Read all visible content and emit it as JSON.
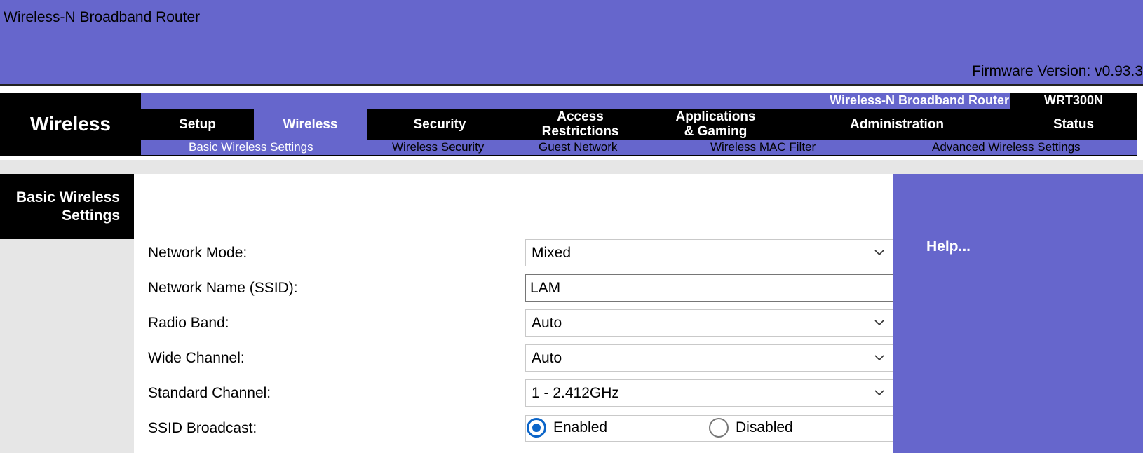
{
  "top": {
    "title": "Wireless-N Broadband Router",
    "firmware": "Firmware Version: v0.93.3"
  },
  "header": {
    "section": "Wireless",
    "product": "Wireless-N Broadband Router",
    "model": "WRT300N",
    "tabs": {
      "setup": "Setup",
      "wireless": "Wireless",
      "security": "Security",
      "access_1": "Access",
      "access_2": "Restrictions",
      "apps_1": "Applications",
      "apps_2": "& Gaming",
      "administration": "Administration",
      "status": "Status"
    },
    "subtabs": {
      "basic": "Basic Wireless Settings",
      "security": "Wireless Security",
      "guest": "Guest Network",
      "mac": "Wireless MAC Filter",
      "advanced": "Advanced Wireless Settings"
    }
  },
  "left": {
    "title_1": "Basic Wireless",
    "title_2": "Settings"
  },
  "help": {
    "label": "Help..."
  },
  "form": {
    "network_mode": {
      "label": "Network Mode:",
      "value": "Mixed"
    },
    "ssid": {
      "label": "Network Name (SSID):",
      "value": "LAM"
    },
    "radio_band": {
      "label": "Radio Band:",
      "value": "Auto"
    },
    "wide_channel": {
      "label": "Wide Channel:",
      "value": "Auto"
    },
    "standard_channel": {
      "label": "Standard Channel:",
      "value": "1 - 2.412GHz"
    },
    "ssid_broadcast": {
      "label": "SSID Broadcast:",
      "enabled": "Enabled",
      "disabled": "Disabled",
      "selected": "Enabled"
    }
  },
  "colors": {
    "accent": "#6666cc",
    "header": "#000000",
    "panel": "#e6e6e6",
    "radio": "#0a64c8"
  }
}
